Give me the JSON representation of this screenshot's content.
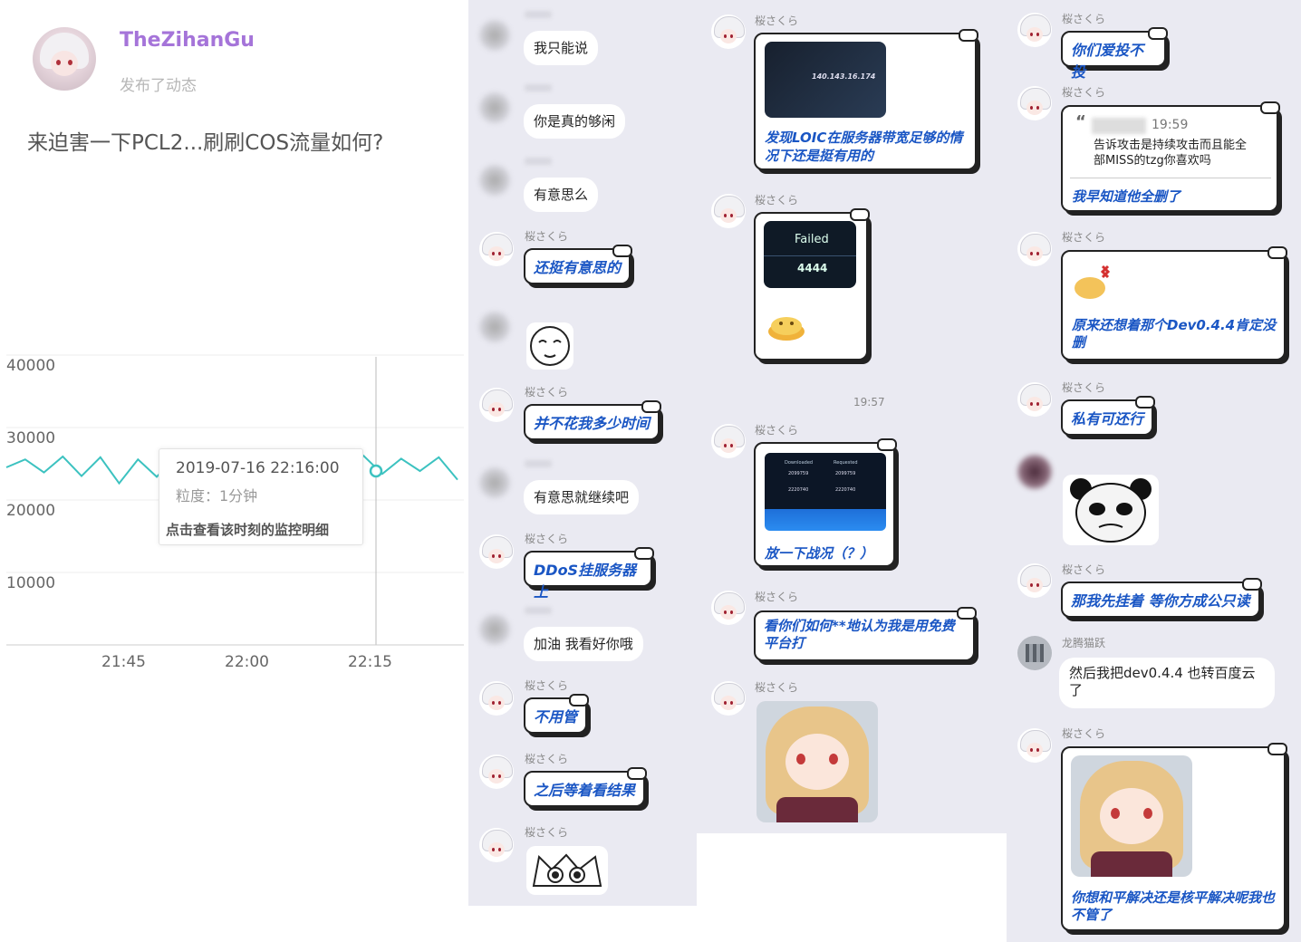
{
  "post": {
    "username": "TheZihanGu",
    "action": "发布了动态",
    "text": "来迫害一下PCL2...刷刷COS流量如何?"
  },
  "chart_data": {
    "type": "line",
    "yticks": [
      "40000",
      "30000",
      "20000",
      "10000"
    ],
    "xticks": [
      "21:45",
      "22:00",
      "22:15"
    ],
    "ylim": [
      0,
      40000
    ],
    "series": [
      {
        "values": [
          24500,
          25600,
          23800,
          26000,
          23300,
          25900,
          22300,
          25600,
          23200,
          26000,
          23700,
          25800,
          24500,
          25400,
          23600,
          26000,
          22700,
          25600,
          23300,
          26100,
          23600,
          25700,
          24000,
          25900,
          22800
        ]
      }
    ],
    "accent": "#3cc2c0",
    "tooltip": {
      "time": "2019-07-16 22:16:00",
      "granularity": "粒度：1分钟",
      "link": "点击查看该时刻的监控明细"
    }
  },
  "chat1": {
    "sender_name": "桜さくら",
    "messages": [
      {
        "text": "我只能说"
      },
      {
        "text": "你是真的够闲"
      },
      {
        "text": "有意思么"
      },
      {
        "text": "还挺有意思的"
      },
      {
        "text": "并不花我多少时间"
      },
      {
        "text": "有意思就继续吧"
      },
      {
        "text": "DDoS挂服务器上"
      },
      {
        "text": "加油 我看好你哦"
      },
      {
        "text": "不用管"
      },
      {
        "text": "之后等着看结果"
      }
    ]
  },
  "chat2": {
    "sender_name": "桜さくら",
    "loic_ip": "140.143.16.174",
    "loic_caption": "发现LOIC在服务器带宽足够的情况下还是挺有用的",
    "failed_label": "Failed",
    "failed_value": "4444",
    "timestamp": "19:57",
    "table_headers": [
      "Downloaded",
      "Requested"
    ],
    "table_rows": [
      [
        "2099759",
        "2099759"
      ],
      [
        "2220740",
        "2220740"
      ]
    ],
    "result_caption": "放一下战况（？）",
    "msg_free": "看你们如何**地认为我是用免费平台打"
  },
  "chat3": {
    "sender_name": "桜さくら",
    "other_name": "龙腾猫跃",
    "msg1": "你们爱投不投",
    "quote_time": "19:59",
    "quote_text": "告诉攻击是持续攻击而且能全部MISS的tzg你喜欢吗",
    "msg2": "我早知道他全删了",
    "msg3": "原来还想着那个Dev0.4.4肯定没删",
    "msg4": "私有可还行",
    "msg5": "那我先挂着 等你方成公只读",
    "msg6": "然后我把dev0.4.4 也转百度云了",
    "msg7": "你想和平解决还是核平解决呢我也不管了"
  }
}
